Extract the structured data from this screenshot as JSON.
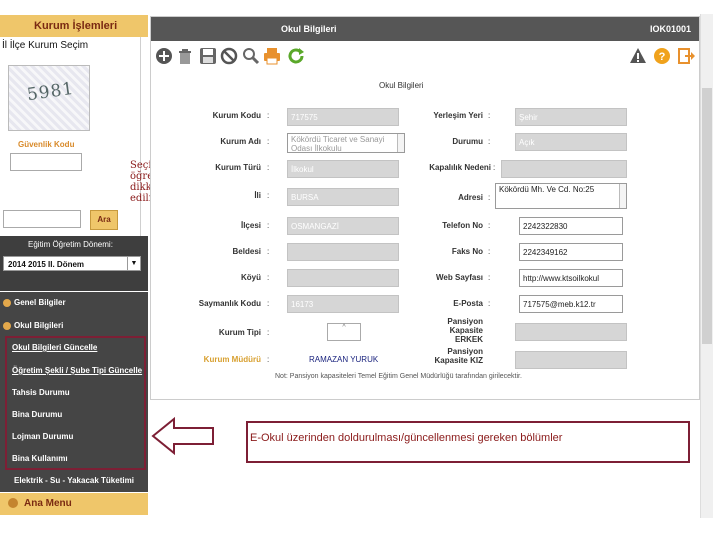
{
  "sidebar": {
    "header": "Kurum İşlemleri",
    "scope_title": "İl İlçe Kurum Seçim",
    "captcha_text": "5981",
    "security_label": "Güvenlik Kodu",
    "search_button": "Ara",
    "term_label": "Eğitim Öğretim Dönemi:",
    "term_value": "2014 2015 II. Dönem",
    "menu": [
      {
        "label": "Genel Bilgiler"
      },
      {
        "label": "Okul Bilgileri"
      }
    ],
    "submenu": [
      {
        "label": "Okul Bilgileri Güncelle"
      },
      {
        "label": "Öğretim Şekli / Şube Tipi Güncelle"
      },
      {
        "label": "Tahsis Durumu"
      },
      {
        "label": "Bina Durumu"
      },
      {
        "label": "Lojman Durumu"
      },
      {
        "label": "Bina Kullanımı"
      },
      {
        "label": "Elektrik - Su - Yakacak Tüketimi"
      }
    ],
    "main_menu": "Ana Menu"
  },
  "main": {
    "title": "Okul Bilgileri",
    "code": "IOK01001",
    "section": "Okul Bilgileri",
    "fields_left": [
      {
        "label": "Kurum Kodu",
        "value": "717575"
      },
      {
        "label": "Kurum Adı",
        "value": "Kökördü Ticaret ve Sanayi Odası İlkokulu"
      },
      {
        "label": "Kurum Türü",
        "value": "İlkokul"
      },
      {
        "label": "İli",
        "value": "BURSA"
      },
      {
        "label": "İlçesi",
        "value": "OSMANGAZİ"
      },
      {
        "label": "Beldesi",
        "value": ""
      },
      {
        "label": "Köyü",
        "value": ""
      },
      {
        "label": "Saymanlık Kodu",
        "value": "16173"
      },
      {
        "label": "Kurum Tipi",
        "value": ""
      },
      {
        "label": "Kurum Müdürü",
        "value": "RAMAZAN YURUK"
      }
    ],
    "fields_right": [
      {
        "label": "Yerleşim Yeri",
        "value": "Şehir"
      },
      {
        "label": "Durumu",
        "value": "Açık"
      },
      {
        "label": "Kapalılık Nedeni",
        "value": ""
      },
      {
        "label": "Adresi",
        "value": "Kökördü Mh. Ve Cd. No:25"
      },
      {
        "label": "Telefon No",
        "value": "2242322830"
      },
      {
        "label": "Faks No",
        "value": "2242349162"
      },
      {
        "label": "Web Sayfası",
        "value": "http://www.ktsoilkokul"
      },
      {
        "label": "E-Posta",
        "value": "717575@meb.k12.tr"
      },
      {
        "label": "Pansiyon Kapasite ERKEK",
        "value": ""
      },
      {
        "label": "Pansiyon Kapasite KIZ",
        "value": ""
      }
    ],
    "kurum_tipi_select": "^",
    "note": "Not: Pansiyon kapasiteleri Temel Eğitim Genel Müdürlüğü tarafından girilecektir."
  },
  "annotations": {
    "left_note": "Seçilen eğitim öğretim yılına dikkat edilmelidir",
    "box_note": "E-Okul üzerinden doldurulması/güncellenmesi gereken bölümler"
  },
  "colors": {
    "accent_gold": "#efc66a",
    "annotation_red": "#c8102e",
    "box_border": "#7d1f35",
    "titlebar": "#565656"
  },
  "icons": [
    "add-icon",
    "trash-icon",
    "save-icon",
    "cancel-icon",
    "search-icon",
    "print-icon",
    "refresh-icon",
    "warning-icon",
    "help-icon",
    "exit-icon",
    "arrow-right-icon",
    "arrow-left-outline-icon"
  ]
}
